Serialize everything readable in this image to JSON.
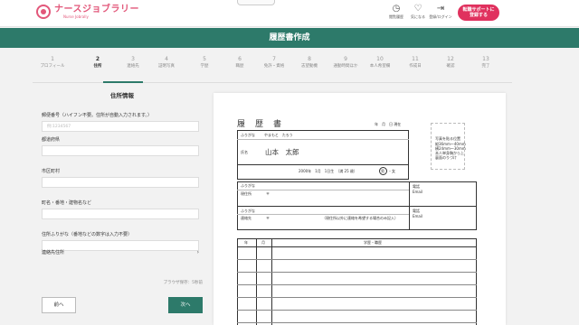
{
  "header": {
    "logo_title": "ナースジョブラリー",
    "logo_sub": "Nurse Jobrally",
    "nav": [
      {
        "icon": "clock-icon",
        "glyph": "◷",
        "label": "閲覧履歴"
      },
      {
        "icon": "heart-icon",
        "glyph": "♡",
        "label": "気になる"
      },
      {
        "icon": "login-icon",
        "glyph": "⇥",
        "label": "登録/ログイン"
      }
    ],
    "support_line1": "転職サポートに",
    "support_line2": "登録する"
  },
  "title": "履歴書作成",
  "steps": [
    {
      "n": "1",
      "t": "プロフィール"
    },
    {
      "n": "2",
      "t": "住所"
    },
    {
      "n": "3",
      "t": "連絡先"
    },
    {
      "n": "4",
      "t": "証明写真"
    },
    {
      "n": "5",
      "t": "学歴"
    },
    {
      "n": "6",
      "t": "職歴"
    },
    {
      "n": "7",
      "t": "免許・資格"
    },
    {
      "n": "8",
      "t": "志望動機"
    },
    {
      "n": "9",
      "t": "通勤時間ほか"
    },
    {
      "n": "10",
      "t": "本人希望欄"
    },
    {
      "n": "11",
      "t": "作成日"
    },
    {
      "n": "12",
      "t": "確認"
    },
    {
      "n": "13",
      "t": "完了"
    }
  ],
  "active_step": 2,
  "form": {
    "section_title": "住所情報",
    "fields": [
      {
        "label": "郵便番号（ハイフン不要。住所が自動入力されます。）",
        "placeholder": "例:1234567"
      },
      {
        "label": "都道府県",
        "placeholder": ""
      },
      {
        "label": "市区町村",
        "placeholder": ""
      },
      {
        "label": "町名・番地・建物名など",
        "placeholder": ""
      },
      {
        "label": "住所ふりがな（番地などの数字は入力不要）",
        "placeholder": ""
      }
    ],
    "contact_label": "連絡先住所",
    "saved_text": "ブラウザ保存：5秒前",
    "prev": "前へ",
    "next": "次へ"
  },
  "resume": {
    "title": "履　歴　書",
    "date": "年　月　日 現在",
    "furigana_label": "ふりがな",
    "furigana_value": "やまもと　たろう",
    "name_label": "氏名",
    "name_value": "山本　太郎",
    "birth": "2000年　1月　1日生　（満 25 歳）",
    "gender_m": "男",
    "gender_f": "・女",
    "photo_lines": [
      "写真を貼る位置",
      "縦36mm〜40mm",
      "横24mm〜30mm",
      "本人単身胸から上",
      "裏面のりづけ"
    ],
    "address_furigana": "ふりがな",
    "address_label": "現住所",
    "address_mark": "〒",
    "phone_label": "電話",
    "email_label": "Email",
    "contact_furigana": "ふりがな",
    "contact_label": "連絡先",
    "contact_mark": "〒",
    "contact_note": "（現住所以外に連絡を希望する場合のみ記入）",
    "history_year": "年",
    "history_month": "月",
    "history_title": "学歴・職歴"
  }
}
